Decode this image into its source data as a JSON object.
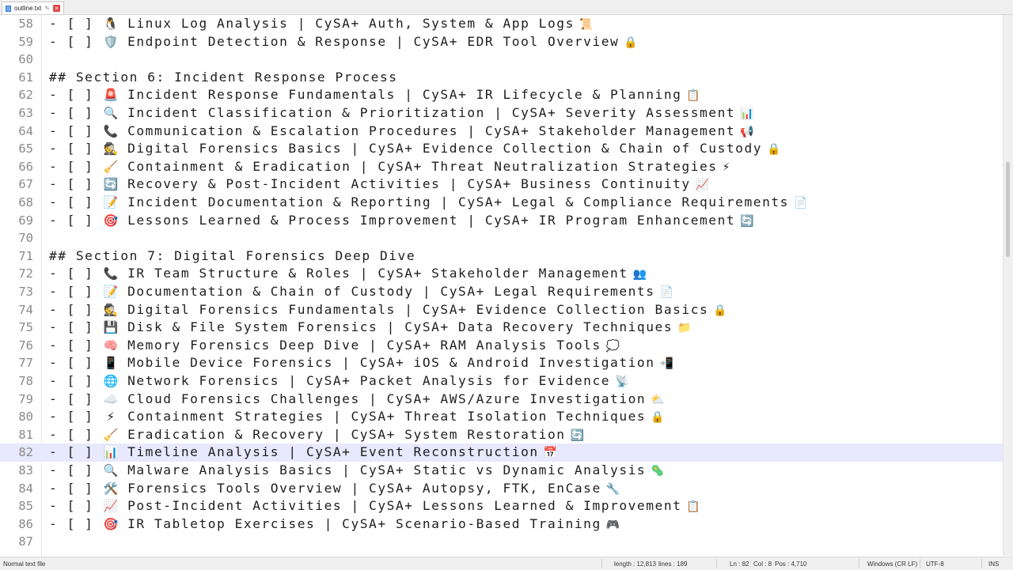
{
  "tab": {
    "filename": "outline.txt",
    "close": "×"
  },
  "editor": {
    "lines": [
      {
        "n": "58",
        "text": "- [ ] ",
        "icon": "🐧",
        "icon_name": "penguin-icon",
        "body": "Linux Log Analysis | CySA+ Auth, System & App Logs",
        "end": "📜",
        "end_name": "scroll-icon"
      },
      {
        "n": "59",
        "text": "- [ ] ",
        "icon": "🛡️",
        "icon_name": "shield-icon",
        "body": "Endpoint Detection & Response | CySA+ EDR Tool Overview",
        "end": "🔒",
        "end_name": "lock-icon"
      },
      {
        "n": "60",
        "text": "",
        "icon": "",
        "icon_name": "",
        "body": "",
        "end": "",
        "end_name": ""
      },
      {
        "n": "61",
        "text": "## Section 6: Incident Response Process",
        "icon": "",
        "icon_name": "",
        "body": "",
        "end": "",
        "end_name": ""
      },
      {
        "n": "62",
        "text": "- [ ] ",
        "icon": "🚨",
        "icon_name": "siren-icon",
        "body": "Incident Response Fundamentals | CySA+ IR Lifecycle & Planning",
        "end": "📋",
        "end_name": "clipboard-icon"
      },
      {
        "n": "63",
        "text": "- [ ] ",
        "icon": "🔍",
        "icon_name": "magnifier-icon",
        "body": "Incident Classification & Prioritization | CySA+ Severity Assessment",
        "end": "📊",
        "end_name": "bar-chart-icon"
      },
      {
        "n": "64",
        "text": "- [ ] ",
        "icon": "📞",
        "icon_name": "phone-icon",
        "body": "Communication & Escalation Procedures | CySA+ Stakeholder Management",
        "end": "📢",
        "end_name": "megaphone-icon"
      },
      {
        "n": "65",
        "text": "- [ ] ",
        "icon": "🕵️",
        "icon_name": "detective-icon",
        "body": "Digital Forensics Basics | CySA+ Evidence Collection & Chain of Custody",
        "end": "🔒",
        "end_name": "lock-icon"
      },
      {
        "n": "66",
        "text": "- [ ] ",
        "icon": "🧹",
        "icon_name": "broom-icon",
        "body": "Containment & Eradication | CySA+ Threat Neutralization Strategies",
        "end": "⚡",
        "end_name": "lightning-icon"
      },
      {
        "n": "67",
        "text": "- [ ] ",
        "icon": "🔄",
        "icon_name": "refresh-icon",
        "body": "Recovery & Post-Incident Activities | CySA+ Business Continuity",
        "end": "📈",
        "end_name": "trend-chart-icon"
      },
      {
        "n": "68",
        "text": "- [ ] ",
        "icon": "📝",
        "icon_name": "memo-icon",
        "body": "Incident Documentation & Reporting | CySA+ Legal & Compliance Requirements",
        "end": "📄",
        "end_name": "document-icon"
      },
      {
        "n": "69",
        "text": "- [ ] ",
        "icon": "🎯",
        "icon_name": "target-icon",
        "body": "Lessons Learned & Process Improvement | CySA+ IR Program Enhancement",
        "end": "🔄",
        "end_name": "refresh-icon"
      },
      {
        "n": "70",
        "text": "",
        "icon": "",
        "icon_name": "",
        "body": "",
        "end": "",
        "end_name": ""
      },
      {
        "n": "71",
        "text": "## Section 7: Digital Forensics Deep Dive",
        "icon": "",
        "icon_name": "",
        "body": "",
        "end": "",
        "end_name": ""
      },
      {
        "n": "72",
        "text": "- [ ] ",
        "icon": "📞",
        "icon_name": "phone-icon",
        "body": "IR Team Structure & Roles | CySA+ Stakeholder Management",
        "end": "👥",
        "end_name": "people-icon"
      },
      {
        "n": "73",
        "text": "- [ ] ",
        "icon": "📝",
        "icon_name": "memo-icon",
        "body": "Documentation & Chain of Custody | CySA+ Legal Requirements",
        "end": "📄",
        "end_name": "document-icon"
      },
      {
        "n": "74",
        "text": "- [ ] ",
        "icon": "🕵️",
        "icon_name": "detective-icon",
        "body": "Digital Forensics Fundamentals | CySA+ Evidence Collection Basics",
        "end": "🔒",
        "end_name": "lock-icon"
      },
      {
        "n": "75",
        "text": "- [ ] ",
        "icon": "💾",
        "icon_name": "floppy-disk-icon",
        "body": "Disk & File System Forensics | CySA+ Data Recovery Techniques",
        "end": "📁",
        "end_name": "folder-icon"
      },
      {
        "n": "76",
        "text": "- [ ] ",
        "icon": "🧠",
        "icon_name": "brain-icon",
        "body": "Memory Forensics Deep Dive | CySA+ RAM Analysis Tools",
        "end": "💭",
        "end_name": "thought-bubble-icon"
      },
      {
        "n": "77",
        "text": "- [ ] ",
        "icon": "📱",
        "icon_name": "mobile-phone-icon",
        "body": "Mobile Device Forensics | CySA+ iOS & Android Investigation",
        "end": "📲",
        "end_name": "mobile-arrow-icon"
      },
      {
        "n": "78",
        "text": "- [ ] ",
        "icon": "🌐",
        "icon_name": "globe-icon",
        "body": "Network Forensics | CySA+ Packet Analysis for Evidence",
        "end": "📡",
        "end_name": "satellite-icon"
      },
      {
        "n": "79",
        "text": "- [ ] ",
        "icon": "☁️",
        "icon_name": "cloud-icon",
        "body": "Cloud Forensics Challenges | CySA+ AWS/Azure Investigation",
        "end": "⛅",
        "end_name": "sun-cloud-icon"
      },
      {
        "n": "80",
        "text": "- [ ] ",
        "icon": "⚡",
        "icon_name": "lightning-icon",
        "body": "Containment Strategies | CySA+ Threat Isolation Techniques",
        "end": "🔒",
        "end_name": "lock-icon"
      },
      {
        "n": "81",
        "text": "- [ ] ",
        "icon": "🧹",
        "icon_name": "broom-icon",
        "body": "Eradication & Recovery | CySA+ System Restoration",
        "end": "🔄",
        "end_name": "refresh-icon"
      },
      {
        "n": "82",
        "text": "- [ ] ",
        "icon": "📊",
        "icon_name": "bar-chart-icon",
        "body": "Timeline Analysis | CySA+ Event Reconstruction",
        "end": "📅",
        "end_name": "calendar-icon",
        "current": true
      },
      {
        "n": "83",
        "text": "- [ ] ",
        "icon": "🔍",
        "icon_name": "magnifier-icon",
        "body": "Malware Analysis Basics | CySA+ Static vs Dynamic Analysis",
        "end": "🦠",
        "end_name": "microbe-icon"
      },
      {
        "n": "84",
        "text": "- [ ] ",
        "icon": "🛠️",
        "icon_name": "tools-icon",
        "body": "Forensics Tools Overview | CySA+ Autopsy, FTK, EnCase",
        "end": "🔧",
        "end_name": "wrench-icon"
      },
      {
        "n": "85",
        "text": "- [ ] ",
        "icon": "📈",
        "icon_name": "trend-chart-icon",
        "body": "Post-Incident Activities | CySA+ Lessons Learned & Improvement",
        "end": "📋",
        "end_name": "clipboard-icon"
      },
      {
        "n": "86",
        "text": "- [ ] ",
        "icon": "🎯",
        "icon_name": "target-icon",
        "body": "IR Tabletop Exercises | CySA+ Scenario-Based Training",
        "end": "🎮",
        "end_name": "game-controller-icon"
      },
      {
        "n": "87",
        "text": "",
        "icon": "",
        "icon_name": "",
        "body": "",
        "end": "",
        "end_name": ""
      }
    ]
  },
  "status": {
    "file_type": "Normal text file",
    "length": "length : 12,813",
    "lines": "lines : 189",
    "ln": "Ln : 82",
    "col": "Col : 8",
    "pos": "Pos : 4,710",
    "eol": "Windows (CR LF)",
    "encoding": "UTF-8",
    "mode": "INS"
  },
  "colors": {
    "current_line": "#e8e8ff",
    "line_number": "#8a8a8a",
    "close_button": "#e04b4b"
  }
}
